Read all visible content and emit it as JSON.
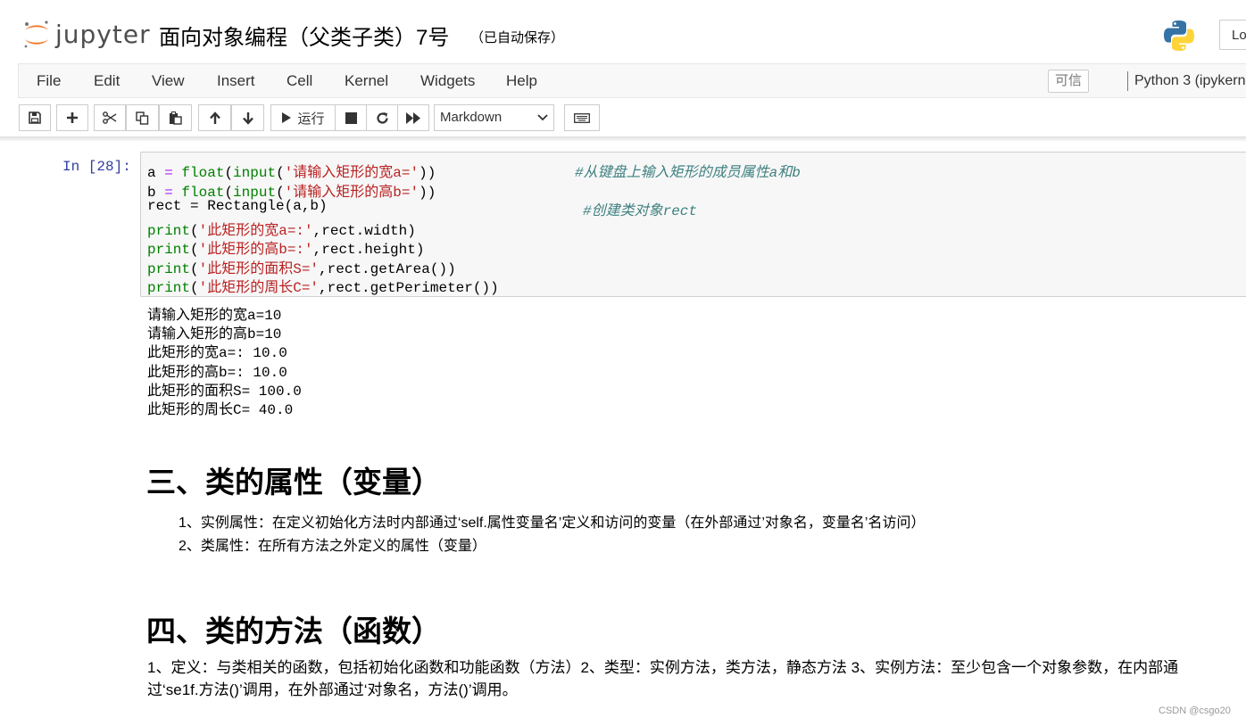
{
  "header": {
    "logo_text": "jupyter",
    "notebook_title": "面向对象编程（父类子类）7号",
    "save_status": "（已自动保存）",
    "login_label": "Lo"
  },
  "menubar": {
    "items": [
      "File",
      "Edit",
      "View",
      "Insert",
      "Cell",
      "Kernel",
      "Widgets",
      "Help"
    ],
    "trusted_label": "可信",
    "kernel_name": "Python 3 (ipykern"
  },
  "toolbar": {
    "run_label": "运行",
    "cell_type": "Markdown"
  },
  "code_cell": {
    "prompt": "In  [28]:",
    "lines": [
      {
        "t1": "a ",
        "op": "=",
        "t2": " ",
        "fn": "float",
        "t3": "(",
        "fn2": "input",
        "t4": "(",
        "s": "'请输入矩形的宽a='",
        "t5": "))",
        "cm": "#从键盘上输入矩形的成员属性a和b"
      },
      {
        "t1": "b ",
        "op": "=",
        "t2": " ",
        "fn": "float",
        "t3": "(",
        "fn2": "input",
        "t4": "(",
        "s": "'请输入矩形的高b='",
        "t5": "))",
        "cm": ""
      },
      {
        "plain": "rect = Rectangle(a,b)",
        "cm": "#创建类对象rect"
      },
      {
        "fn": "print",
        "t3": "(",
        "s": "'此矩形的宽a=:'",
        "t5": ",rect.width)"
      },
      {
        "fn": "print",
        "t3": "(",
        "s": "'此矩形的高b=:'",
        "t5": ",rect.height)"
      },
      {
        "fn": "print",
        "t3": "(",
        "s": "'此矩形的面积S='",
        "t5": ",rect.getArea())"
      },
      {
        "fn": "print",
        "t3": "(",
        "s": "'此矩形的周长C='",
        "t5": ",rect.getPerimeter())"
      }
    ]
  },
  "output_lines": [
    "请输入矩形的宽a=10",
    "请输入矩形的高b=10",
    "此矩形的宽a=: 10.0",
    "此矩形的高b=: 10.0",
    "此矩形的面积S= 100.0",
    "此矩形的周长C= 40.0"
  ],
  "markdown": {
    "heading_attrs": "三、类的属性（变量）",
    "attrs_items": [
      "1、实例属性：在定义初始化方法时内部通过‘self.属性变量名’定义和访问的变量（在外部通过’对象名，变量名’名访问）",
      "2、类属性：在所有方法之外定义的属性（变量）"
    ],
    "heading_methods": "四、类的方法（函数）",
    "methods_para": "1、定义：与类相关的函数，包括初始化函数和功能函数（方法）2、类型：实例方法，类方法，静态方法 3、实例方法：至少包含一个对象参数，在内部通过‘se1f.方法()’调用，在外部通过‘对象名，方法()’调用。"
  },
  "watermark": "CSDN @csgo20"
}
